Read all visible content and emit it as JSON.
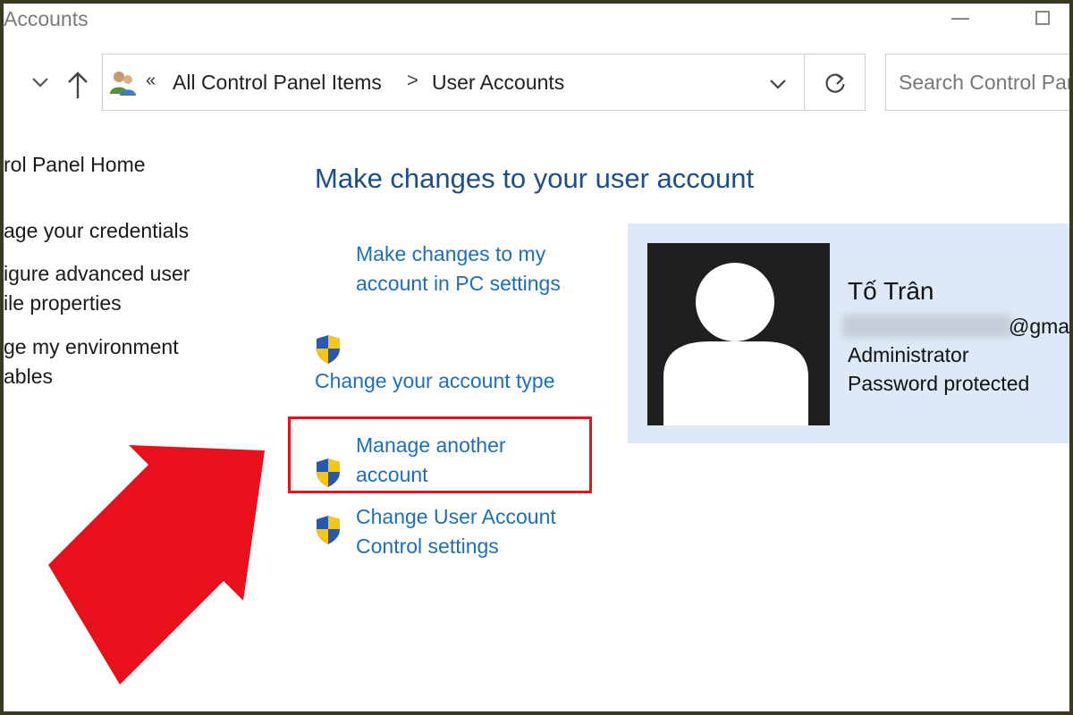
{
  "window": {
    "title": "Accounts"
  },
  "address": {
    "overflow": "«",
    "crumbs": [
      "All Control Panel Items",
      "User Accounts"
    ],
    "separator": ">"
  },
  "search": {
    "placeholder": "Search Control Pan"
  },
  "sidebar": {
    "items": [
      {
        "lines": [
          "rol Panel Home"
        ]
      },
      {
        "lines": [
          "age your credentials"
        ]
      },
      {
        "lines": [
          "igure advanced user",
          "ile properties"
        ]
      },
      {
        "lines": [
          "ge my environment",
          "ables"
        ]
      }
    ]
  },
  "main": {
    "title": "Make changes to your user account",
    "tasks": [
      {
        "lines": [
          "Make changes to my",
          "account in PC settings"
        ]
      },
      {
        "lines": [
          "Change your account type"
        ]
      },
      {
        "lines": [
          "Manage another",
          "account"
        ]
      },
      {
        "lines": [
          "Change User Account",
          "Control settings"
        ]
      }
    ]
  },
  "account": {
    "name": "Tố Trân",
    "email_suffix": "@gmail",
    "role": "Administrator",
    "status": "Password protected"
  },
  "colors": {
    "accent_link": "#1e6fb8",
    "title_blue": "#1e4e86",
    "highlight_red": "#e3121b",
    "card_bg": "#dde9f6"
  }
}
